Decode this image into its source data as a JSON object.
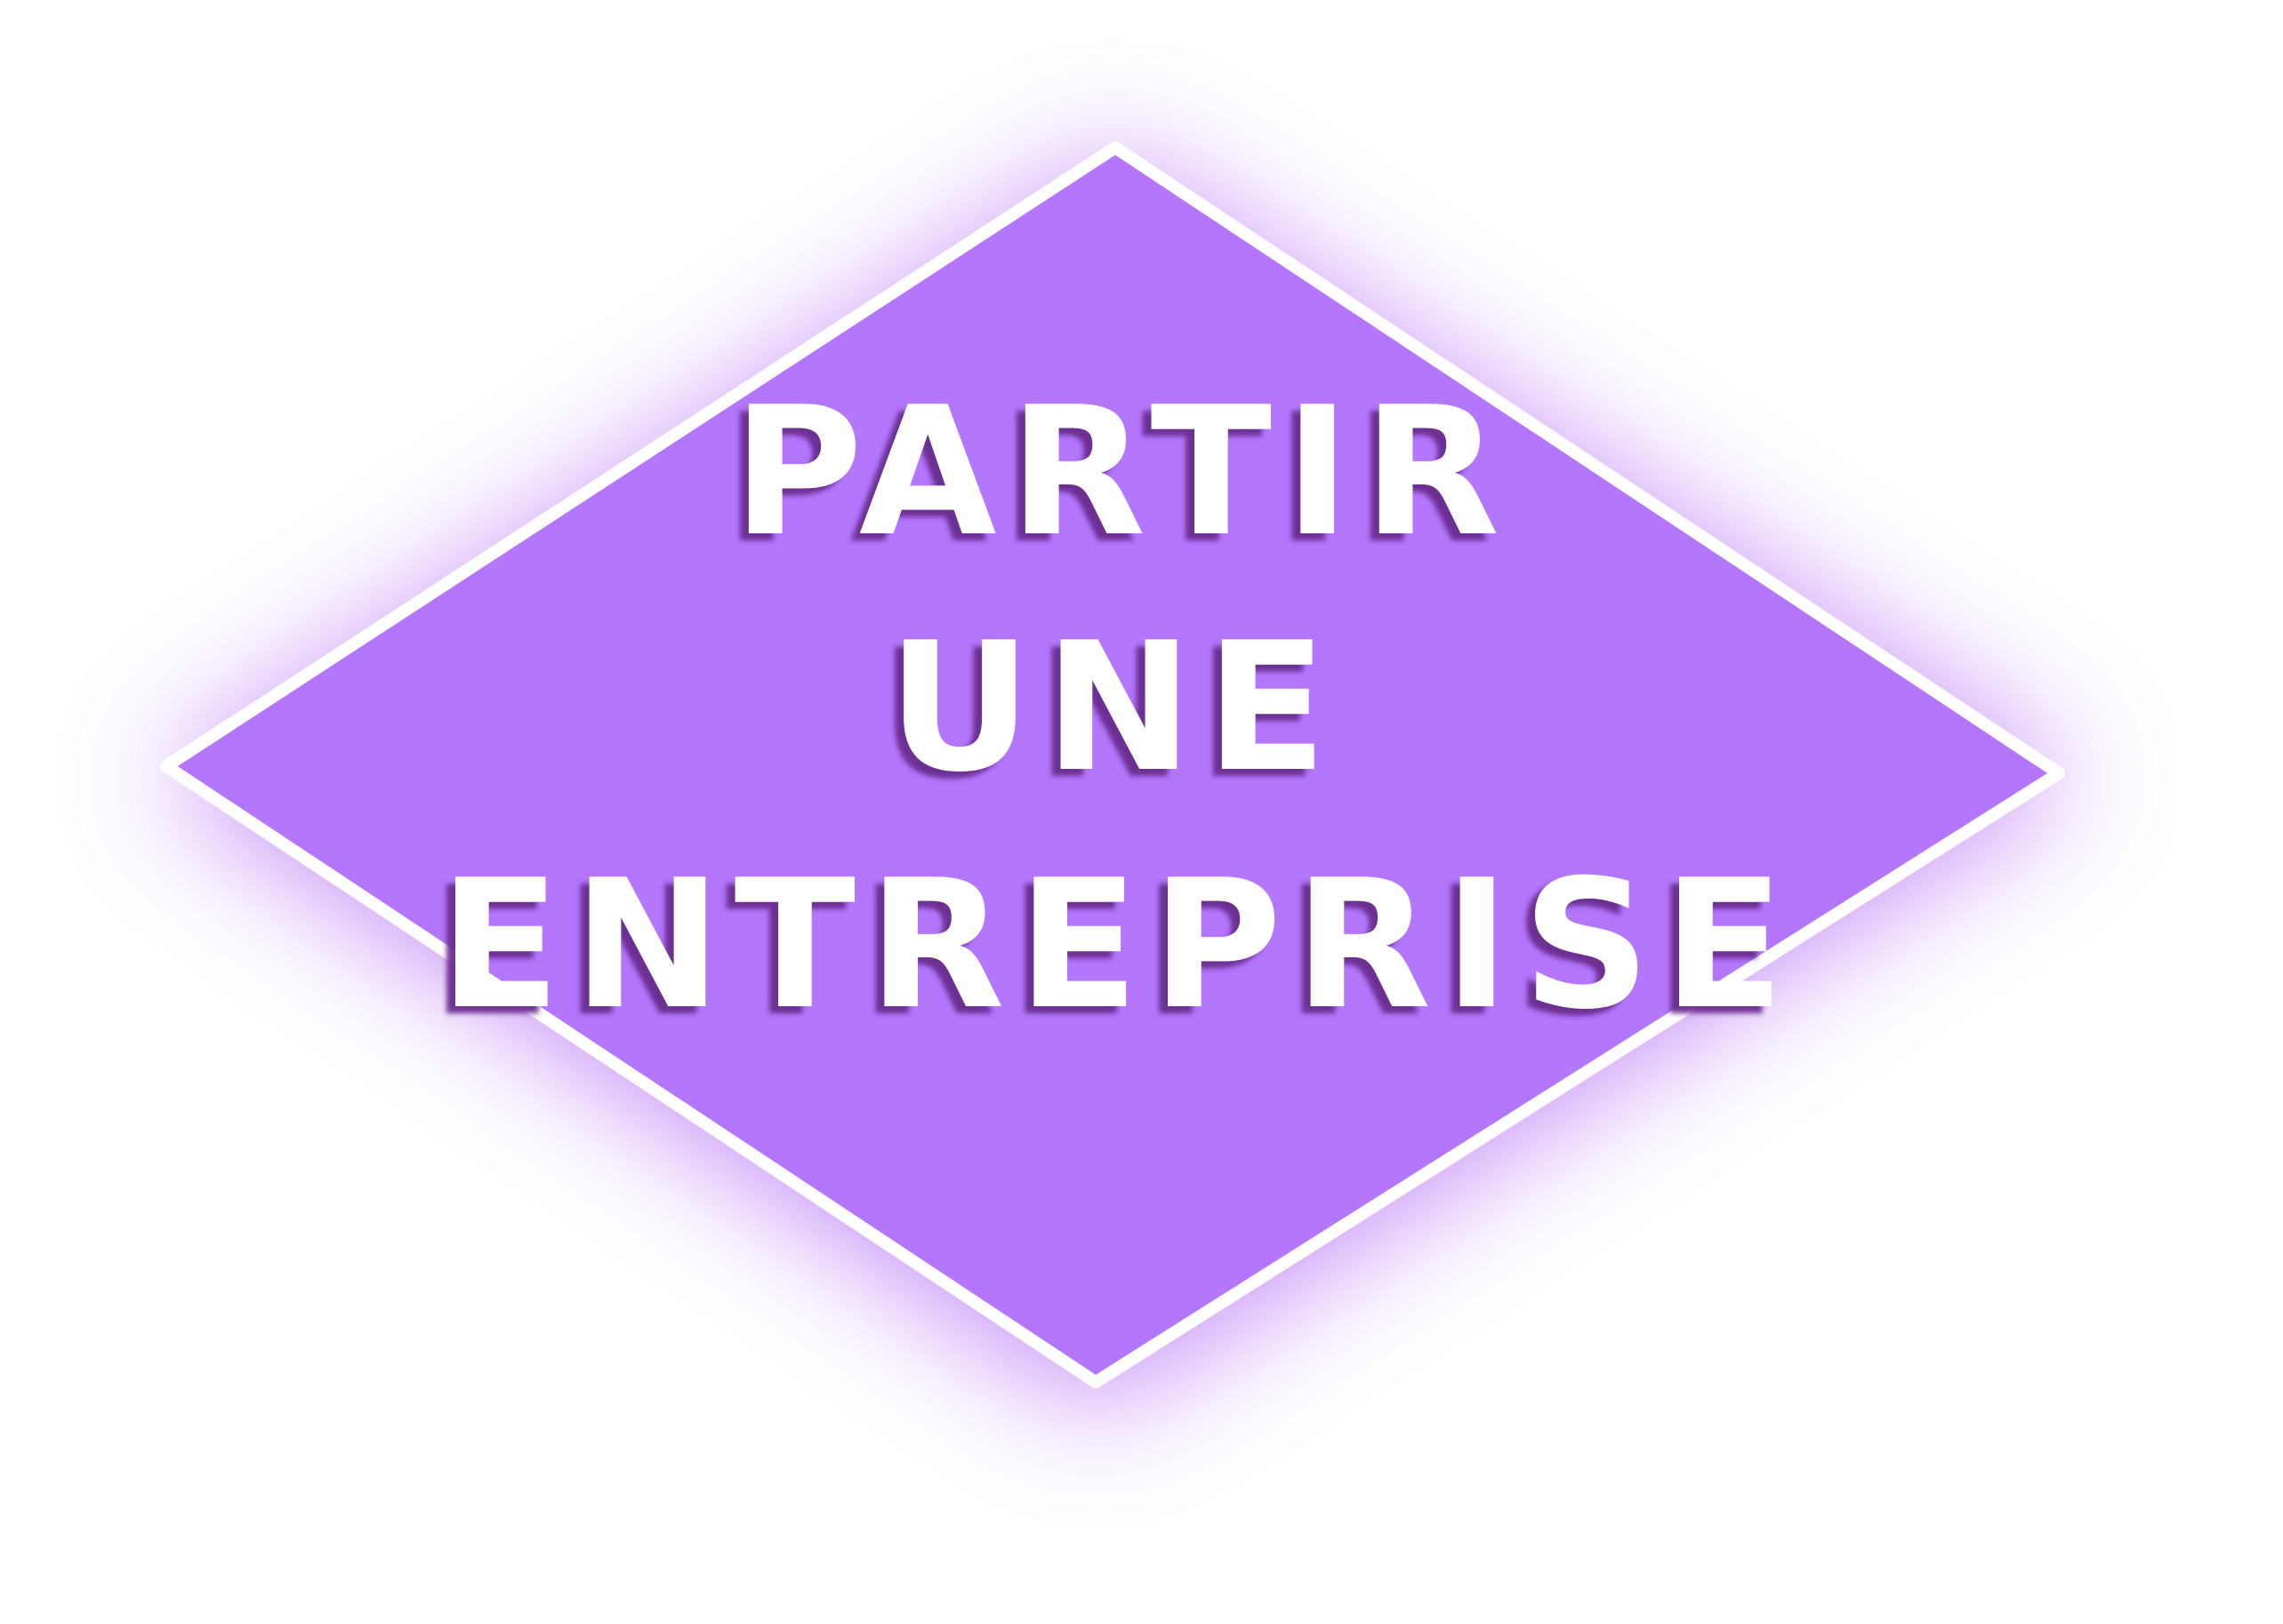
{
  "sign": {
    "lines": [
      "PARTIR",
      "UNE",
      "ENTREPRISE"
    ]
  },
  "colors": {
    "fill": "#b376fd",
    "border": "#ffffff",
    "glow": "#b164f5",
    "text": "#ffffff",
    "text_shadow": "#6a2a8e",
    "background": "#ffffff"
  }
}
